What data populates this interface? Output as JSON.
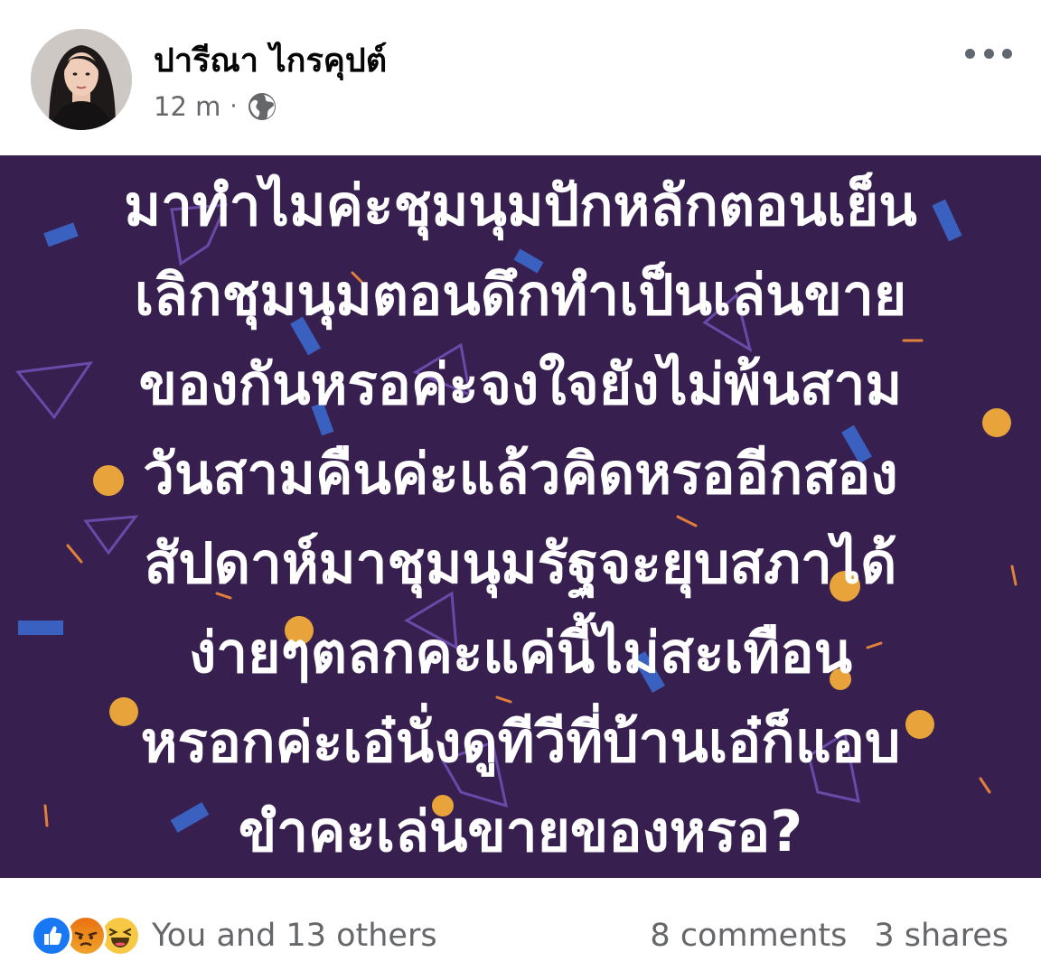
{
  "post": {
    "author": {
      "name": "ปารีณา ไกรคุปต์",
      "avatar_icon": "profile-photo"
    },
    "meta": {
      "time": "12 m",
      "separator": "·",
      "privacy_icon": "globe-icon"
    },
    "more_icon": "more-horizontal-icon",
    "image": {
      "background_color": "#37204f",
      "text_color": "#ffffff",
      "lines": [
        "มาทำไมค่ะชุมนุมปักหลักตอนเย็น",
        "เลิกชุมนุมตอนดึกทำเป็นเล่นขาย",
        "ของกันหรอค่ะจงใจยังไม่พ้นสาม",
        "วันสามคืนค่ะแล้วคิดหรออีกสอง",
        "สัปดาห์มาชุมนุมรัฐจะยุบสภาได้",
        "ง่ายๆตลกคะแค่นี้ไม่สะเทือน",
        "หรอกค่ะเอ๋นั่งดูทีวีที่บ้านเอ๋ก็แอบ",
        "ขำคะเล่นขายของหรอ?"
      ]
    },
    "footer": {
      "reaction_icons": [
        "like-icon",
        "angry-icon",
        "haha-icon"
      ],
      "reactors": "You and 13 others",
      "comments": "8 comments",
      "shares": "3 shares"
    },
    "colors": {
      "like_blue": "#1877f2",
      "secondary_text": "#65676b"
    }
  }
}
